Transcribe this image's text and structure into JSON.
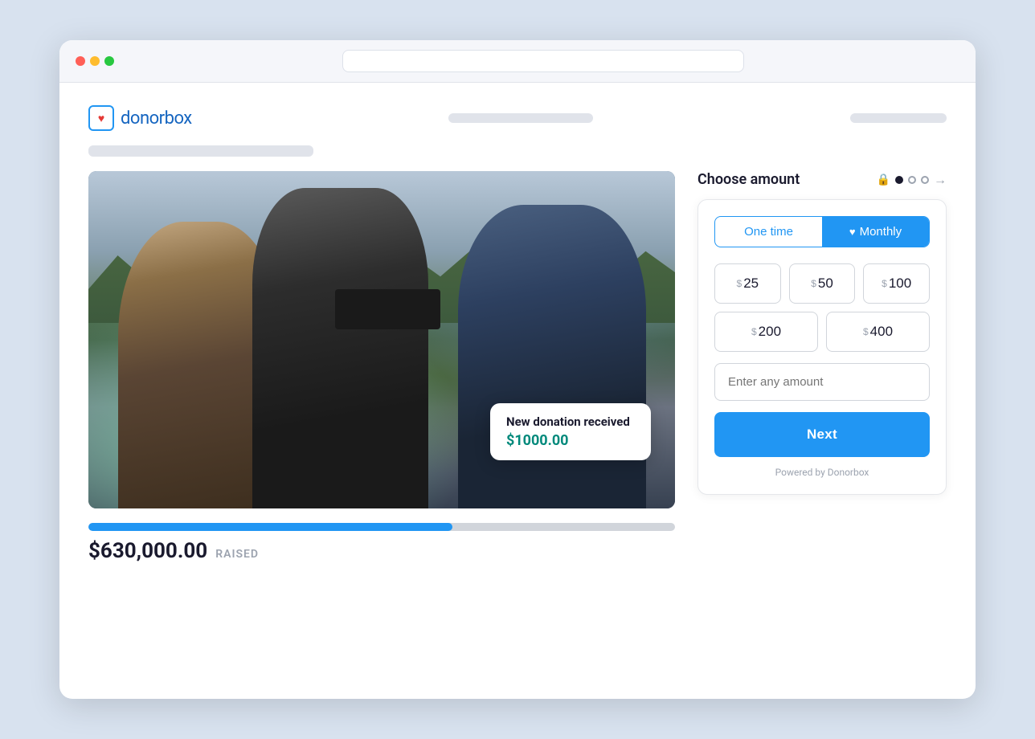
{
  "browser": {
    "dots": [
      "red",
      "yellow",
      "green"
    ]
  },
  "header": {
    "logo_text": "donorbox",
    "title_placeholder": ""
  },
  "campaign": {
    "notification": {
      "title": "New donation received",
      "amount": "$1000.00"
    },
    "progress": {
      "raised_amount": "$630,000.00",
      "raised_label": "RAISED",
      "percent": 62
    }
  },
  "donation_form": {
    "section_title": "Choose amount",
    "frequency": {
      "one_time_label": "One time",
      "monthly_label": "Monthly",
      "active": "monthly"
    },
    "amounts": [
      {
        "value": "25",
        "currency": "$"
      },
      {
        "value": "50",
        "currency": "$"
      },
      {
        "value": "100",
        "currency": "$"
      },
      {
        "value": "200",
        "currency": "$"
      },
      {
        "value": "400",
        "currency": "$"
      }
    ],
    "custom_amount_placeholder": "Enter any amount",
    "next_button_label": "Next",
    "powered_by": "Powered by Donorbox"
  }
}
